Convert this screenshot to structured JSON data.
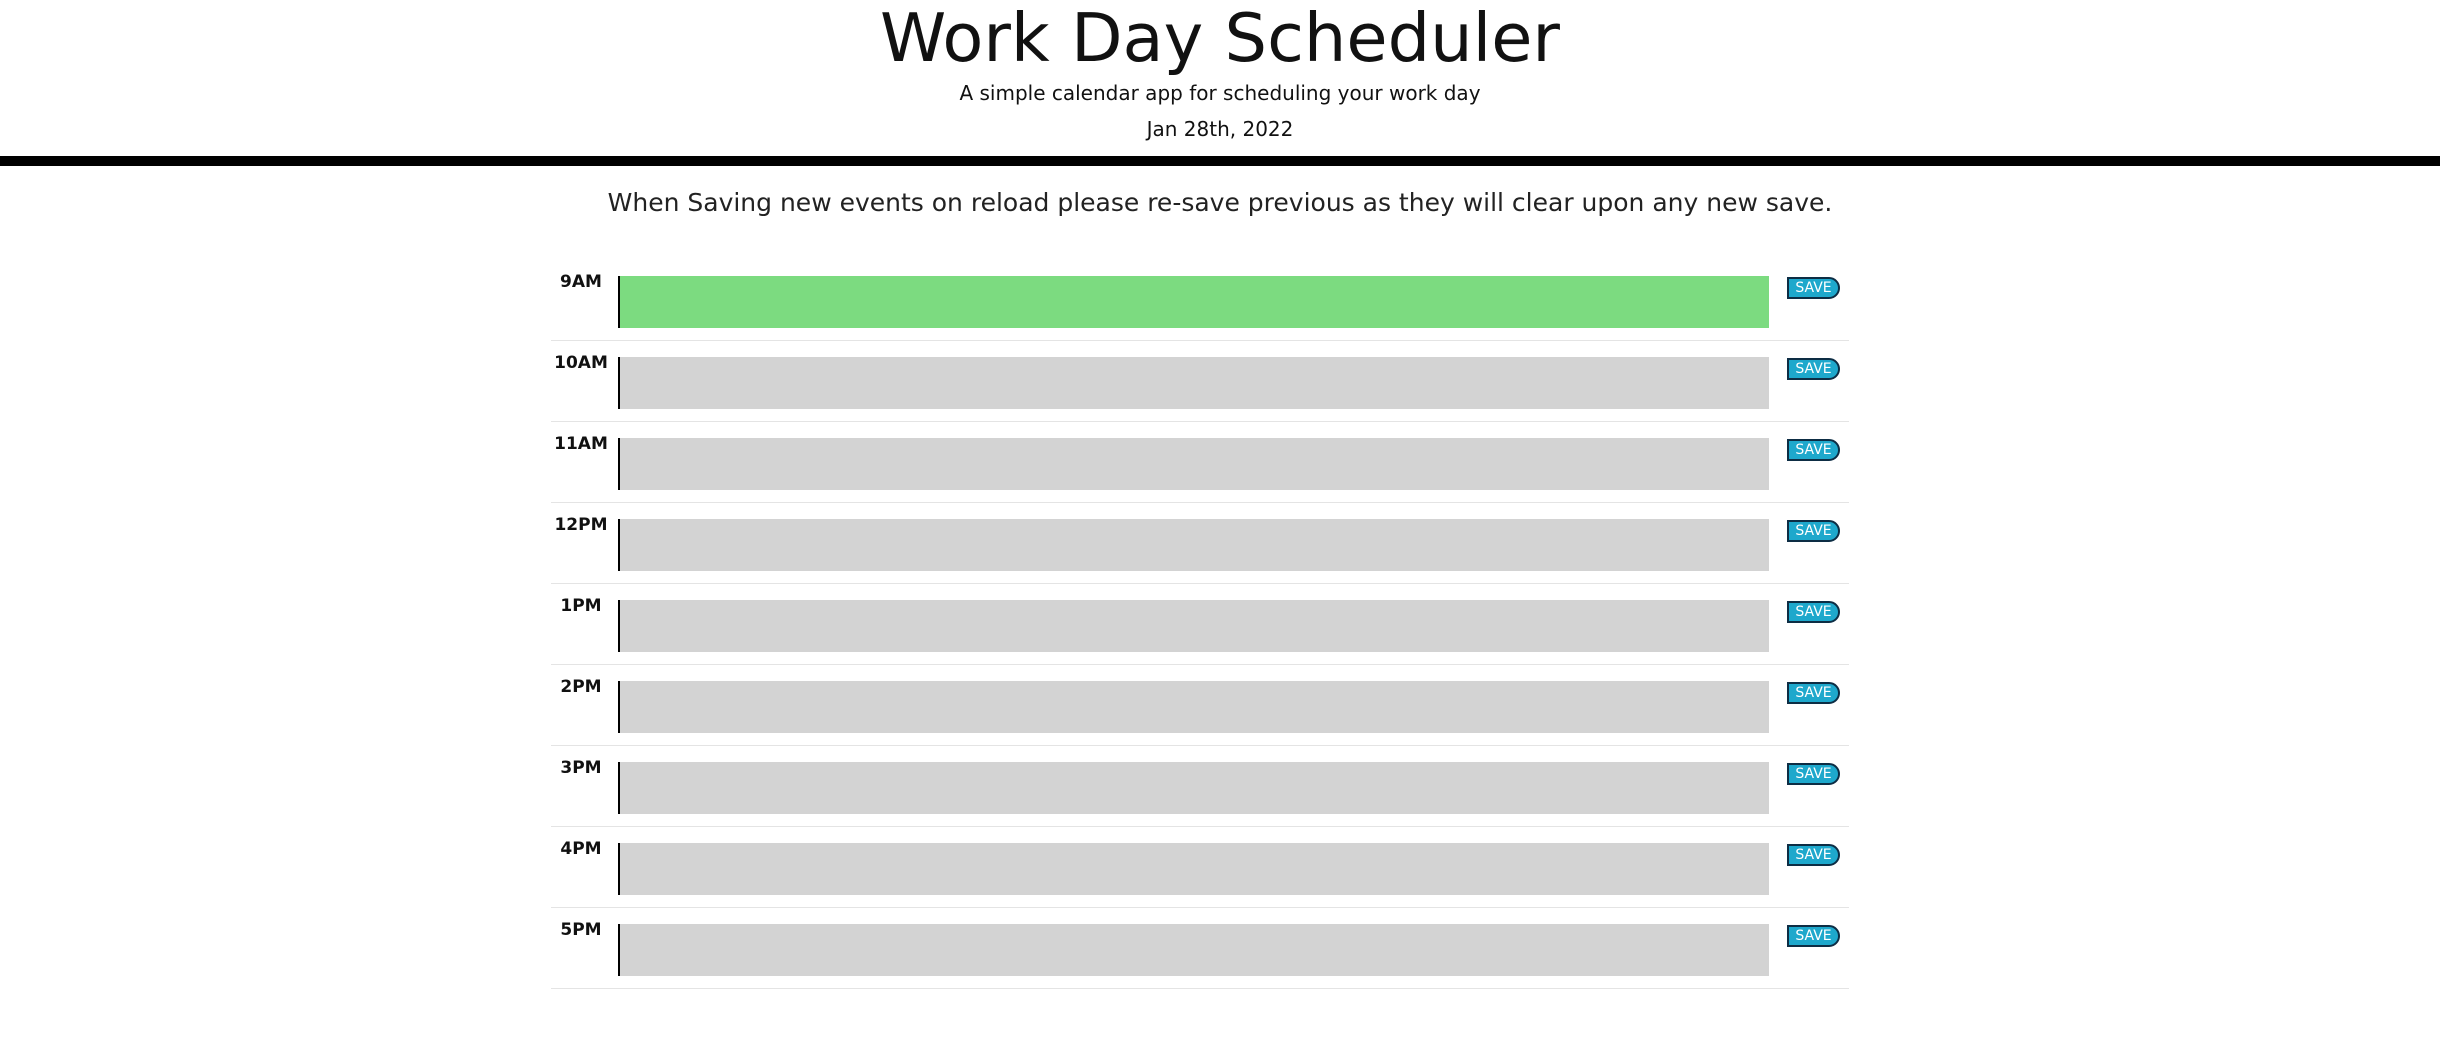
{
  "header": {
    "title": "Work Day Scheduler",
    "subtitle": "A simple calendar app for scheduling your work day",
    "current_day": "Jan 28th, 2022"
  },
  "notice": "When Saving new events on reload please re-save previous as they will clear upon any new save.",
  "colors": {
    "present": "#7cdb80",
    "future": "#d3d3d3",
    "save_button": "#1ea8cc"
  },
  "time_blocks": [
    {
      "hour": "9AM",
      "status": "present",
      "event_text": "",
      "save_label": "SAVE"
    },
    {
      "hour": "10AM",
      "status": "future",
      "event_text": "",
      "save_label": "SAVE"
    },
    {
      "hour": "11AM",
      "status": "future",
      "event_text": "",
      "save_label": "SAVE"
    },
    {
      "hour": "12PM",
      "status": "future",
      "event_text": "",
      "save_label": "SAVE"
    },
    {
      "hour": "1PM",
      "status": "future",
      "event_text": "",
      "save_label": "SAVE"
    },
    {
      "hour": "2PM",
      "status": "future",
      "event_text": "",
      "save_label": "SAVE"
    },
    {
      "hour": "3PM",
      "status": "future",
      "event_text": "",
      "save_label": "SAVE"
    },
    {
      "hour": "4PM",
      "status": "future",
      "event_text": "",
      "save_label": "SAVE"
    },
    {
      "hour": "5PM",
      "status": "future",
      "event_text": "",
      "save_label": "SAVE"
    }
  ]
}
